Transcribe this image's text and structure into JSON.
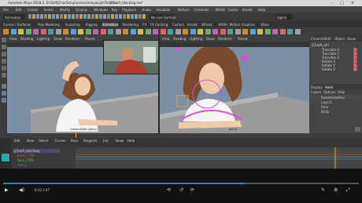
{
  "window": {
    "title_left": "Autodesk Maya 2018.3: D:\\Self\\jCharSetup\\scenes\\mayaLightTest.ma",
    "title_right": "jCharA_blocking.ma*"
  },
  "menubar": {
    "items": [
      "File",
      "Edit",
      "Create",
      "Select",
      "Modify",
      "Display",
      "Windows",
      "Key",
      "Playback",
      "Audio",
      "Visualize",
      "Deform",
      "Constrain",
      "MASH",
      "Cache",
      "Arnold",
      "Help"
    ]
  },
  "statusline": {
    "mode": "Animation",
    "layout": "No Live Surface",
    "search": "Signin"
  },
  "shelf": {
    "tabs": [
      "Curves / Surfaces",
      "Poly Modeling",
      "Sculpting",
      "Rigging",
      "Animation",
      "Rendering",
      "FX",
      "FX Caching",
      "Custom",
      "Arnold",
      "Bifrost",
      "MASH",
      "Motion Graphics",
      "XGen"
    ],
    "active_tab": "Animation"
  },
  "viewport_left": {
    "menu": [
      "View",
      "Shading",
      "Lighting",
      "Show",
      "Renderer",
      "Panels"
    ],
    "camera_label": "CameraSide (Jenny)"
  },
  "viewport_right": {
    "menu": [
      "View",
      "Shading",
      "Lighting",
      "Show",
      "Renderer",
      "Panels"
    ],
    "camera_label": "persp",
    "axis": "y"
  },
  "channel_box": {
    "tabs": [
      "Channels",
      "Edit",
      "Object",
      "Show"
    ],
    "object": "jCharA_ctrl",
    "channels": [
      {
        "name": "Translate X",
        "value": "0"
      },
      {
        "name": "Translate Y",
        "value": "0"
      },
      {
        "name": "Translate Z",
        "value": "0"
      },
      {
        "name": "Rotate X",
        "value": "0"
      },
      {
        "name": "Rotate Y",
        "value": "0"
      },
      {
        "name": "Rotate Z",
        "value": "0"
      }
    ],
    "layer_tabs": [
      "Display",
      "Anim"
    ],
    "layer_menu": [
      "Layers",
      "Options",
      "Help"
    ],
    "layers": [
      "BaseAnimation",
      "Layer1",
      "Face",
      "Body"
    ]
  },
  "graph_editor": {
    "menu": [
      "Edit",
      "View",
      "Select",
      "Curves",
      "Keys",
      "Tangents",
      "List",
      "Show",
      "Help"
    ],
    "outliner_items": [
      "jCharA_blocking",
      "Body_CTRL",
      "Face_CTRL",
      "Arm_L"
    ]
  },
  "player": {
    "progress": 0.68,
    "time_current": "0:32",
    "time_total": "1:47"
  },
  "colors": {
    "viewport_bg": "#7d8fa5",
    "selection": "#d94fd0",
    "timeline_key": "#e6a23c",
    "player_progress": "#2e7bd6"
  }
}
